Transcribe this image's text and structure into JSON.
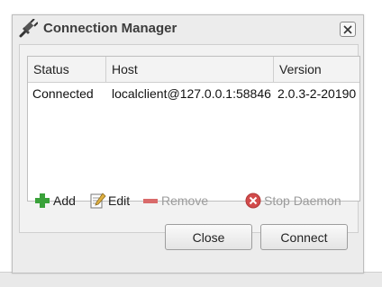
{
  "window": {
    "title": "Connection Manager",
    "title_icon": "plug-icon",
    "close_icon": "close-icon"
  },
  "table": {
    "columns": [
      "Status",
      "Host",
      "Version"
    ],
    "rows": [
      {
        "status": "Connected",
        "host": "localclient@127.0.0.1:58846",
        "version": "2.0.3-2-20190"
      }
    ]
  },
  "toolbar": {
    "add_label": "Add",
    "edit_label": "Edit",
    "remove_label": "Remove",
    "stop_daemon_label": "Stop Daemon"
  },
  "buttons": {
    "close_label": "Close",
    "connect_label": "Connect"
  },
  "colors": {
    "add_green": "#3aa13a",
    "remove_red": "#d96a6a",
    "stop_red": "#d24b4b"
  }
}
